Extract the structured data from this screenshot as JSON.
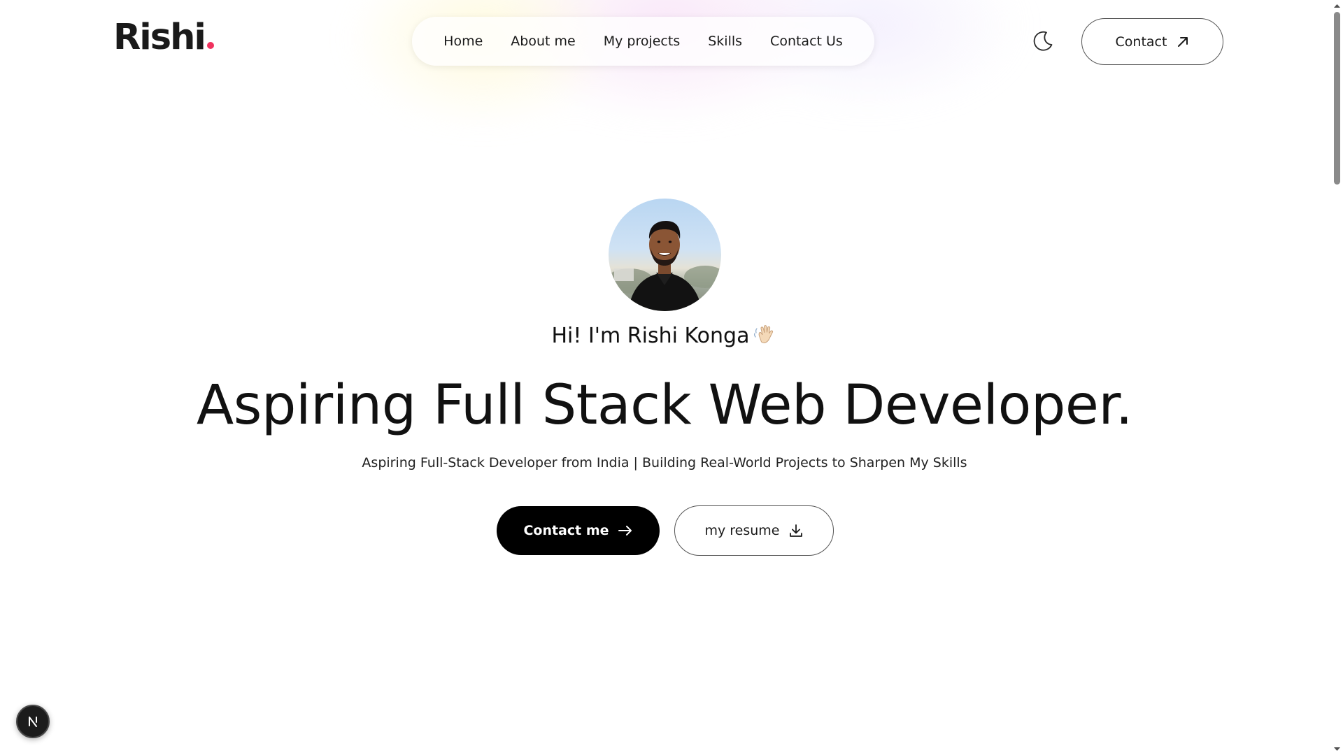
{
  "header": {
    "logo_text": "Rishi",
    "logo_dot_color": "#f0325e",
    "nav": [
      {
        "label": "Home"
      },
      {
        "label": "About me"
      },
      {
        "label": "My projects"
      },
      {
        "label": "Skills"
      },
      {
        "label": "Contact Us"
      }
    ],
    "theme_toggle_icon": "moon-icon",
    "contact_label": "Contact",
    "contact_icon": "arrow-up-right-icon"
  },
  "hero": {
    "avatar_alt": "profile-photo",
    "greeting": "Hi! I'm Rishi Konga",
    "greeting_icon": "waving-hand-icon",
    "headline": "Aspiring Full Stack Web Developer.",
    "subtitle": "Aspiring Full-Stack Developer from India | Building Real-World Projects to Sharpen My Skills",
    "primary_cta": {
      "label": "Contact me",
      "icon": "arrow-right-icon"
    },
    "secondary_cta": {
      "label": "my resume",
      "icon": "download-icon"
    }
  },
  "dev_badge": {
    "letter": "N",
    "icon": "nextjs-logo-icon"
  },
  "colors": {
    "accent": "#f0325e",
    "primary_button_bg": "#000000",
    "text": "#111111"
  }
}
